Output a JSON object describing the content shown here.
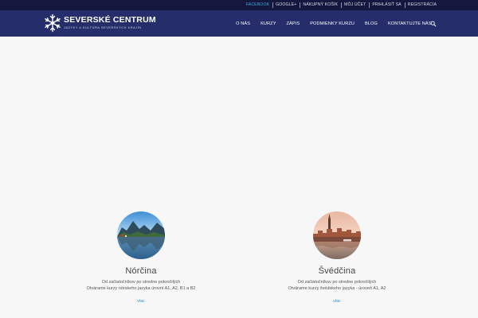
{
  "topbar": {
    "links": [
      {
        "label": "FACEBOOK",
        "active": true
      },
      {
        "label": "GOOGLE+",
        "active": false
      },
      {
        "label": "NÁKUPNÝ KOŠÍK",
        "active": false
      },
      {
        "label": "MÔJ ÚČET",
        "active": false
      },
      {
        "label": "PRIHLÁSIŤ SA",
        "active": false
      },
      {
        "label": "REGISTRÁCIA",
        "active": false
      }
    ]
  },
  "header": {
    "brand_title": "SEVERSKÉ CENTRUM",
    "brand_subtitle": "JAZYKY A KULTÚRA SEVERSKÝCH KRAJÍN",
    "nav": [
      "O NÁS",
      "KURZY",
      "ZÁPIS",
      "PODMIENKY KURZU",
      "BLOG",
      "KONTAKTUJTE NÁS"
    ],
    "search_icon": "search-icon"
  },
  "courses": [
    {
      "title": "Nórčina",
      "desc_line1": "Od začiatočníkov po stredne pokročilých",
      "desc_line2": "Otvárame kurzy nórskeho jazyka úrovní A1, A2, B1 a B2",
      "link": "viac",
      "image": "fjord-landscape"
    },
    {
      "title": "Švédčina",
      "desc_line1": "Od začiatočníkov po stredne pokročilých",
      "desc_line2": "Otvárame kurzy švédskeho jazyka - úroveň A1, A2",
      "link": "viac",
      "image": "stockholm-cityscape"
    }
  ],
  "colors": {
    "topbar_bg": "#15183e",
    "header_bg": "#252d6b",
    "active_link": "#3aa6d8",
    "link": "#2d8fd0",
    "page_bg": "#f7f7f7"
  }
}
